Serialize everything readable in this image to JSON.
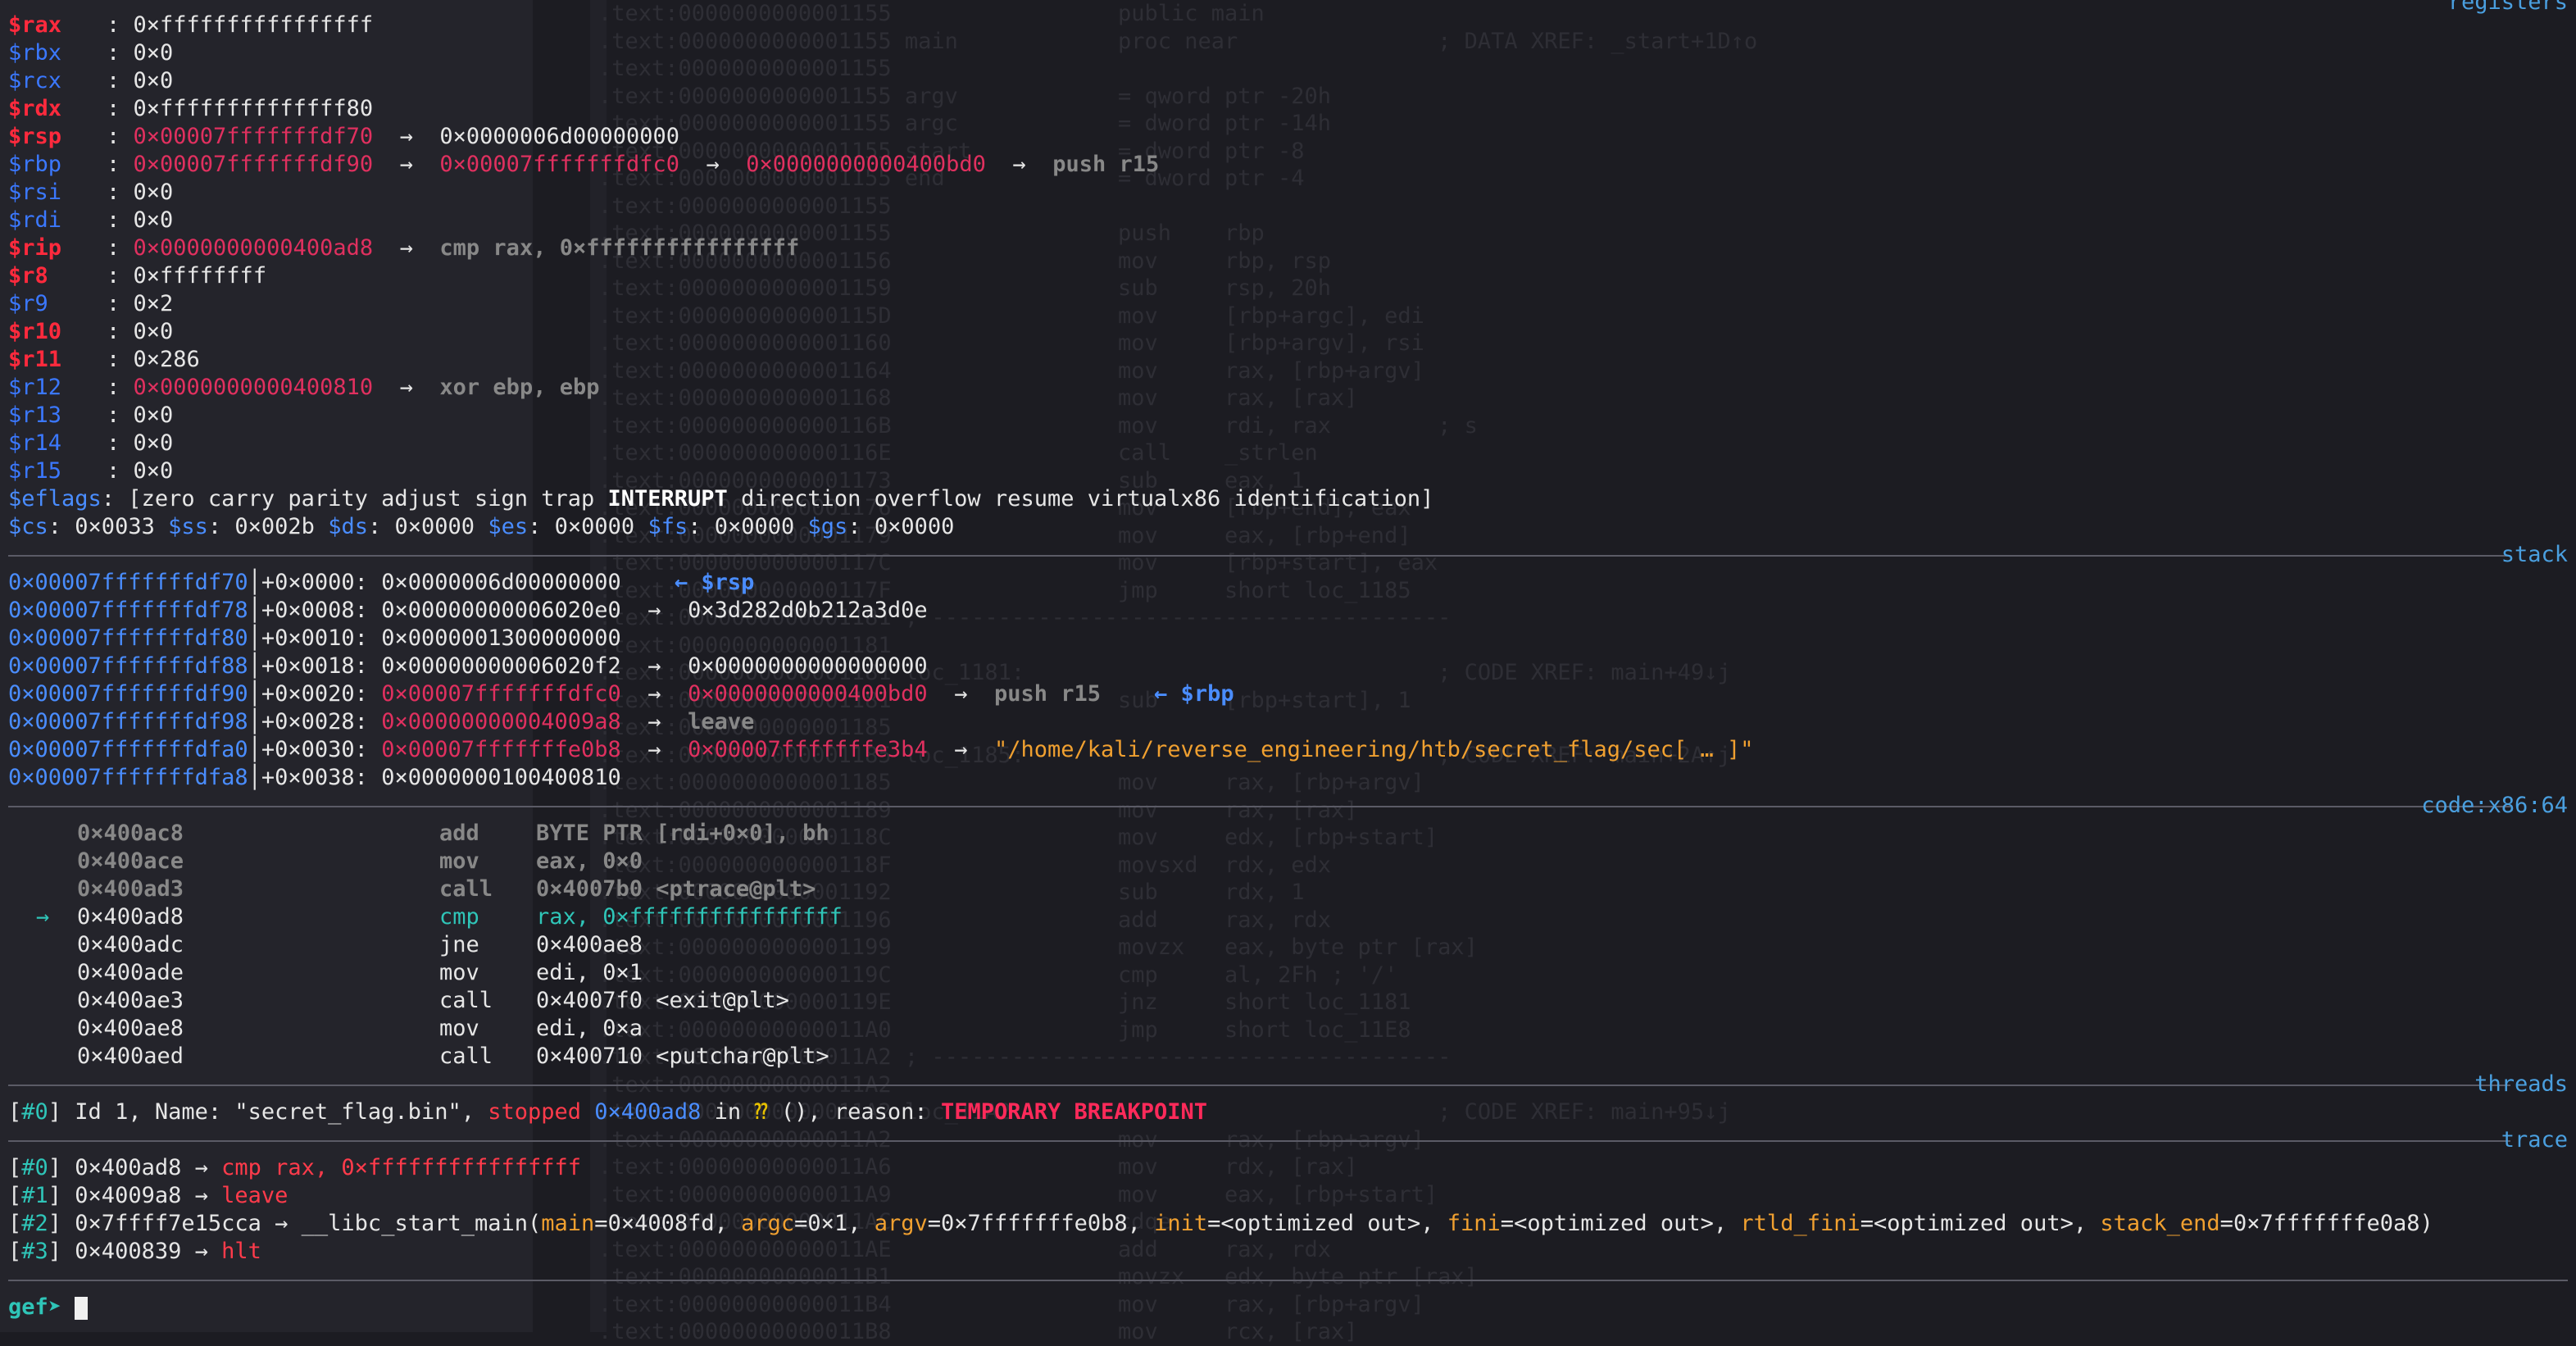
{
  "registers": [
    {
      "name": "$rax",
      "value": "0×ffffffffffffffff",
      "changed": true
    },
    {
      "name": "$rbx",
      "value": "0×0",
      "changed": false
    },
    {
      "name": "$rcx",
      "value": "0×0",
      "changed": false
    },
    {
      "name": "$rdx",
      "value": "0×ffffffffffffff80",
      "changed": true
    },
    {
      "name": "$rsp",
      "value": "0×00007fffffffdf70",
      "changed": true,
      "chain": [
        "0×0000006d00000000"
      ]
    },
    {
      "name": "$rbp",
      "value": "0×00007fffffffdf90",
      "changed": false,
      "chain": [
        "0×00007fffffffdfc0",
        "0×0000000000400bd0",
        "push r15"
      ]
    },
    {
      "name": "$rsi",
      "value": "0×0",
      "changed": false
    },
    {
      "name": "$rdi",
      "value": "0×0",
      "changed": false
    },
    {
      "name": "$rip",
      "value": "0×0000000000400ad8",
      "changed": true,
      "chain": [
        "cmp rax, 0×ffffffffffffffff"
      ]
    },
    {
      "name": "$r8",
      "value": "0×ffffffff",
      "changed": true
    },
    {
      "name": "$r9",
      "value": "0×2",
      "changed": false
    },
    {
      "name": "$r10",
      "value": "0×0",
      "changed": true
    },
    {
      "name": "$r11",
      "value": "0×286",
      "changed": true
    },
    {
      "name": "$r12",
      "value": "0×0000000000400810",
      "changed": false,
      "chain": [
        "xor ebp, ebp"
      ]
    },
    {
      "name": "$r13",
      "value": "0×0",
      "changed": false
    },
    {
      "name": "$r14",
      "value": "0×0",
      "changed": false
    },
    {
      "name": "$r15",
      "value": "0×0",
      "changed": false
    }
  ],
  "eflags": {
    "label": "$eflags",
    "pre": ": [zero carry parity adjust sign trap ",
    "bold": "INTERRUPT",
    "post": " direction overflow resume virtualx86 identification]"
  },
  "segments": [
    {
      "name": "$cs",
      "value": "0×0033"
    },
    {
      "name": "$ss",
      "value": "0×002b"
    },
    {
      "name": "$ds",
      "value": "0×0000"
    },
    {
      "name": "$es",
      "value": "0×0000"
    },
    {
      "name": "$fs",
      "value": "0×0000"
    },
    {
      "name": "$gs",
      "value": "0×0000"
    }
  ],
  "sections": {
    "registers": "registers",
    "stack": "stack",
    "code": "code:x86:64",
    "threads": "threads",
    "trace": "trace"
  },
  "stack": [
    {
      "addr": "0×00007fffffffdf70",
      "off": "+0×0000:",
      "val": "0×0000006d00000000",
      "tag": "← $rsp"
    },
    {
      "addr": "0×00007fffffffdf78",
      "off": "+0×0008:",
      "val": "0×00000000006020e0",
      "deref": "0×3d282d0b212a3d0e"
    },
    {
      "addr": "0×00007fffffffdf80",
      "off": "+0×0010:",
      "val": "0×0000001300000000"
    },
    {
      "addr": "0×00007fffffffdf88",
      "off": "+0×0018:",
      "val": "0×00000000006020f2",
      "deref": "0×0000000000000000"
    },
    {
      "addr": "0×00007fffffffdf90",
      "off": "+0×0020:",
      "val": "0×00007fffffffdfc0",
      "deref": "0×0000000000400bd0",
      "inst": "push r15",
      "tag": "← $rbp"
    },
    {
      "addr": "0×00007fffffffdf98",
      "off": "+0×0028:",
      "val": "0×00000000004009a8",
      "inst": "leave"
    },
    {
      "addr": "0×00007fffffffdfa0",
      "off": "+0×0030:",
      "val": "0×00007fffffffe0b8",
      "deref": "0×00007fffffffe3b4",
      "str": "\"/home/kali/reverse_engineering/htb/secret_flag/sec[ … ]\""
    },
    {
      "addr": "0×00007fffffffdfa8",
      "off": "+0×0038:",
      "val": "0×0000000100400810"
    }
  ],
  "code": [
    {
      "marker": "",
      "addr": "0×400ac8",
      "mn": "add",
      "ops": "BYTE PTR [rdi+0×0], bh",
      "state": "past"
    },
    {
      "marker": "",
      "addr": "0×400ace",
      "mn": "mov",
      "ops": "eax, 0×0",
      "state": "past"
    },
    {
      "marker": "",
      "addr": "0×400ad3",
      "mn": "call",
      "ops": "0×4007b0 <ptrace@plt>",
      "state": "past"
    },
    {
      "marker": "→",
      "addr": "0×400ad8",
      "mn": "cmp",
      "ops": "rax, 0×ffffffffffffffff",
      "state": "current"
    },
    {
      "marker": "",
      "addr": "0×400adc",
      "mn": "jne",
      "ops": "0×400ae8",
      "state": "next"
    },
    {
      "marker": "",
      "addr": "0×400ade",
      "mn": "mov",
      "ops": "edi, 0×1",
      "state": "next"
    },
    {
      "marker": "",
      "addr": "0×400ae3",
      "mn": "call",
      "ops": "0×4007f0 <exit@plt>",
      "state": "next"
    },
    {
      "marker": "",
      "addr": "0×400ae8",
      "mn": "mov",
      "ops": "edi, 0×a",
      "state": "next"
    },
    {
      "marker": "",
      "addr": "0×400aed",
      "mn": "call",
      "ops": "0×400710 <putchar@plt>",
      "state": "next"
    }
  ],
  "thread": {
    "idx": "#0",
    "pre": " Id 1, Name: \"secret_flag.bin\", ",
    "stopped": "stopped",
    "addr": "0×400ad8",
    "in": " in ",
    "func": "⁇",
    "mid": " (), reason: ",
    "reason": "TEMPORARY BREAKPOINT"
  },
  "trace": [
    {
      "idx": "#0",
      "addr": "0×400ad8",
      "sym": "cmp rax, 0×ffffffffffffffff"
    },
    {
      "idx": "#1",
      "addr": "0×4009a8",
      "sym": "leave"
    },
    {
      "idx": "#2",
      "addr": "0×7ffff7e15cca",
      "sym": "__libc_start_main",
      "args": [
        {
          "k": "main",
          "v": "0×4008fd"
        },
        {
          "k": "argc",
          "v": "0×1"
        },
        {
          "k": "argv",
          "v": "0×7fffffffe0b8"
        },
        {
          "k": "init",
          "v": "<optimized out>"
        },
        {
          "k": "fini",
          "v": "<optimized out>"
        },
        {
          "k": "rtld_fini",
          "v": "<optimized out>"
        },
        {
          "k": "stack_end",
          "v": "0×7fffffffe0a8"
        }
      ]
    },
    {
      "idx": "#3",
      "addr": "0×400839",
      "sym": "hlt"
    }
  ],
  "prompt": "gef➤",
  "bg_listing": [
    ".text:0000000000001155                 public main",
    ".text:0000000000001155 main            proc near               ; DATA XREF: _start+1D↑o",
    ".text:0000000000001155",
    ".text:0000000000001155 argv            = qword ptr -20h",
    ".text:0000000000001155 argc            = dword ptr -14h",
    ".text:0000000000001155 start           = dword ptr -8",
    ".text:0000000000001155 end             = dword ptr -4",
    ".text:0000000000001155",
    ".text:0000000000001155                 push    rbp",
    ".text:0000000000001156                 mov     rbp, rsp",
    ".text:0000000000001159                 sub     rsp, 20h",
    ".text:000000000000115D                 mov     [rbp+argc], edi",
    ".text:0000000000001160                 mov     [rbp+argv], rsi",
    ".text:0000000000001164                 mov     rax, [rbp+argv]",
    ".text:0000000000001168                 mov     rax, [rax]",
    ".text:000000000000116B                 mov     rdi, rax        ; s",
    ".text:000000000000116E                 call    _strlen",
    ".text:0000000000001173                 sub     eax, 1",
    ".text:0000000000001176                 mov     [rbp+end], eax",
    ".text:0000000000001179                 mov     eax, [rbp+end]",
    ".text:000000000000117C                 mov     [rbp+start], eax",
    ".text:000000000000117F                 jmp     short loc_1185",
    ".text:0000000000001181 ; ---------------------------------------",
    ".text:0000000000001181",
    ".text:0000000000001181 loc_1181:                               ; CODE XREF: main+49↓j",
    ".text:0000000000001181                 sub     [rbp+start], 1",
    ".text:0000000000001185",
    ".text:0000000000001185 loc_1185:                               ; CODE XREF: main+2A↑j",
    ".text:0000000000001185                 mov     rax, [rbp+argv]",
    ".text:0000000000001189                 mov     rax, [rax]",
    ".text:000000000000118C                 mov     edx, [rbp+start]",
    ".text:000000000000118F                 movsxd  rdx, edx",
    ".text:0000000000001192                 sub     rdx, 1",
    ".text:0000000000001196                 add     rax, rdx",
    ".text:0000000000001199                 movzx   eax, byte ptr [rax]",
    ".text:000000000000119C                 cmp     al, 2Fh ; '/'",
    ".text:000000000000119E                 jnz     short loc_1181",
    ".text:00000000000011A0                 jmp     short loc_11E8",
    ".text:00000000000011A2 ; ---------------------------------------",
    ".text:00000000000011A2",
    ".text:00000000000011A2 loc_11A2:                               ; CODE XREF: main+95↓j",
    ".text:00000000000011A2                 mov     rax, [rbp+argv]",
    ".text:00000000000011A6                 mov     rdx, [rax]",
    ".text:00000000000011A9                 mov     eax, [rbp+start]",
    ".text:00000000000011AC                 cdqe",
    ".text:00000000000011AE                 add     rax, rdx",
    ".text:00000000000011B1                 movzx   edx, byte ptr [rax]",
    ".text:00000000000011B4                 mov     rax, [rbp+argv]",
    ".text:00000000000011B8                 mov     rcx, [rax]"
  ]
}
